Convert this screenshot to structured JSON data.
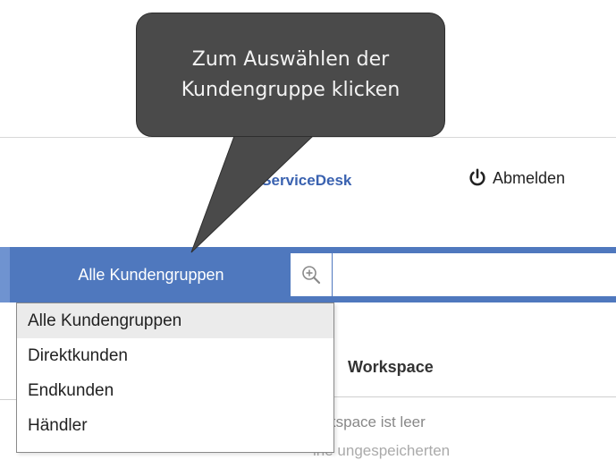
{
  "header": {
    "servicedesk_link": "ion ServiceDesk",
    "logout_label": "Abmelden"
  },
  "toolbar": {
    "group_select_label": "Alle Kundengruppen",
    "search_icon": "zoom-in-icon",
    "search_value": ""
  },
  "dropdown": {
    "options": [
      "Alle Kundengruppen",
      "Direktkunden",
      "Endkunden",
      "Händler"
    ],
    "selected": "Alle Kundengruppen"
  },
  "workspace": {
    "title": "Workspace",
    "empty_text": "orkspace ist leer",
    "unsaved_text": "ine ungespeicherten"
  },
  "tooltip": {
    "line1": "Zum Auswählen der",
    "line2": "Kundengruppe klicken"
  },
  "colors": {
    "bar_blue": "#4f78be",
    "link_blue": "#3a62b0",
    "tooltip_bg": "#4a4a4a"
  }
}
